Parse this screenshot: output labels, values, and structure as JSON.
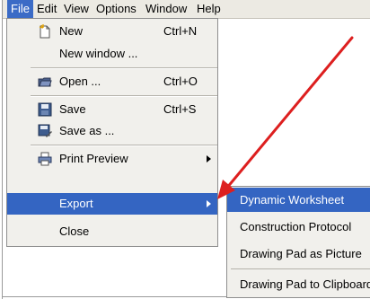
{
  "menubar": {
    "items": [
      "File",
      "Edit",
      "View",
      "Options",
      "Window",
      "Help"
    ]
  },
  "file_menu": {
    "items": [
      {
        "label": "New",
        "shortcut": "Ctrl+N",
        "icon": "new-document-icon"
      },
      {
        "label": "New window ...",
        "shortcut": ""
      },
      {
        "label": "Open ...",
        "shortcut": "Ctrl+O",
        "icon": "open-folder-icon"
      },
      {
        "label": "Save",
        "shortcut": "Ctrl+S",
        "icon": "save-disk-icon"
      },
      {
        "label": "Save as ...",
        "shortcut": "",
        "icon": "save-as-icon"
      },
      {
        "label": "Print Preview",
        "shortcut": "",
        "icon": "printer-icon"
      },
      {
        "label": "Export",
        "shortcut": ""
      },
      {
        "label": "Close",
        "shortcut": ""
      }
    ]
  },
  "export_submenu": {
    "items": [
      "Dynamic Worksheet",
      "Construction Protocol",
      "Drawing Pad as Picture",
      "Drawing Pad to Clipboard"
    ]
  },
  "colors": {
    "highlight": "#3465c2",
    "menu_bg": "#f1f0ec",
    "arrow": "#dd1f1f"
  }
}
